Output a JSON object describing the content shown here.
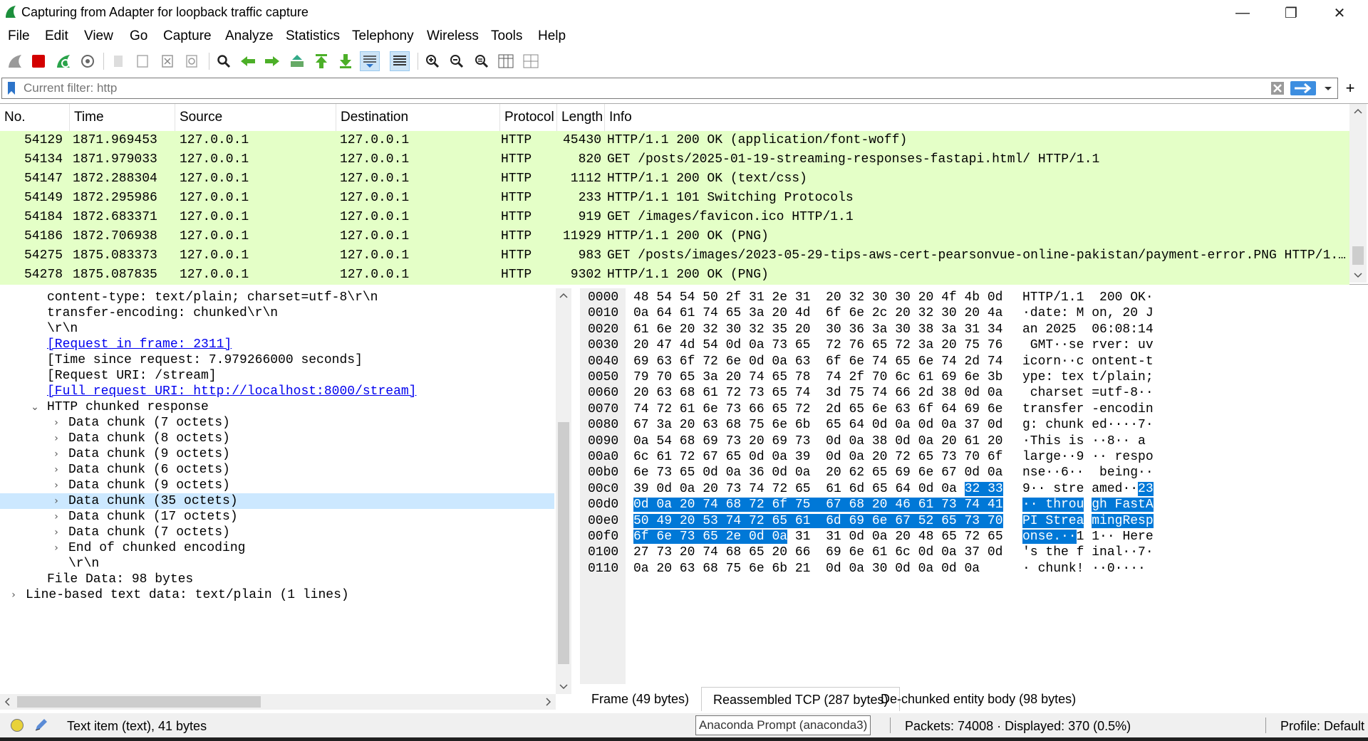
{
  "window": {
    "title": "Capturing from Adapter for loopback traffic capture",
    "minimize": "—",
    "restore": "❐",
    "close": "✕"
  },
  "menu": [
    "File",
    "Edit",
    "View",
    "Go",
    "Capture",
    "Analyze",
    "Statistics",
    "Telephony",
    "Wireless",
    "Tools",
    "Help"
  ],
  "filter": {
    "placeholder": "Current filter: http",
    "add_label": "+"
  },
  "packet_columns": [
    "No.",
    "Time",
    "Source",
    "Destination",
    "Protocol",
    "Length",
    "Info"
  ],
  "packets": [
    {
      "no": "54129",
      "time": "1871.969453",
      "src": "127.0.0.1",
      "dst": "127.0.0.1",
      "proto": "HTTP",
      "len": "45430",
      "info": "HTTP/1.1 200 OK  (application/font-woff)"
    },
    {
      "no": "54134",
      "time": "1871.979033",
      "src": "127.0.0.1",
      "dst": "127.0.0.1",
      "proto": "HTTP",
      "len": "820",
      "info": "GET /posts/2025-01-19-streaming-responses-fastapi.html/ HTTP/1.1"
    },
    {
      "no": "54147",
      "time": "1872.288304",
      "src": "127.0.0.1",
      "dst": "127.0.0.1",
      "proto": "HTTP",
      "len": "1112",
      "info": "HTTP/1.1 200 OK  (text/css)"
    },
    {
      "no": "54149",
      "time": "1872.295986",
      "src": "127.0.0.1",
      "dst": "127.0.0.1",
      "proto": "HTTP",
      "len": "233",
      "info": "HTTP/1.1 101 Switching Protocols"
    },
    {
      "no": "54184",
      "time": "1872.683371",
      "src": "127.0.0.1",
      "dst": "127.0.0.1",
      "proto": "HTTP",
      "len": "919",
      "info": "GET /images/favicon.ico HTTP/1.1"
    },
    {
      "no": "54186",
      "time": "1872.706938",
      "src": "127.0.0.1",
      "dst": "127.0.0.1",
      "proto": "HTTP",
      "len": "11929",
      "info": "HTTP/1.1 200 OK  (PNG)"
    },
    {
      "no": "54275",
      "time": "1875.083373",
      "src": "127.0.0.1",
      "dst": "127.0.0.1",
      "proto": "HTTP",
      "len": "983",
      "info": "GET /posts/images/2023-05-29-tips-aws-cert-pearsonvue-online-pakistan/payment-error.PNG HTTP/1.…"
    },
    {
      "no": "54278",
      "time": "1875.087835",
      "src": "127.0.0.1",
      "dst": "127.0.0.1",
      "proto": "HTTP",
      "len": "9302",
      "info": "HTTP/1.1 200 OK  (PNG)"
    }
  ],
  "detail_rows": [
    {
      "text": "content-type: text/plain; charset=utf-8\\r\\n",
      "indent": 1,
      "twisty": ""
    },
    {
      "text": "transfer-encoding: chunked\\r\\n",
      "indent": 1,
      "twisty": ""
    },
    {
      "text": "\\r\\n",
      "indent": 1,
      "twisty": ""
    },
    {
      "text": "[Request in frame: 2311]",
      "indent": 1,
      "twisty": "",
      "link": true
    },
    {
      "text": "[Time since request: 7.979266000 seconds]",
      "indent": 1,
      "twisty": ""
    },
    {
      "text": "[Request URI: /stream]",
      "indent": 1,
      "twisty": ""
    },
    {
      "text": "[Full request URI: http://localhost:8000/stream]",
      "indent": 1,
      "twisty": "",
      "link": true
    },
    {
      "text": "HTTP chunked response",
      "indent": 1,
      "twisty": "open"
    },
    {
      "text": "Data chunk (7 octets)",
      "indent": 2,
      "twisty": "closed"
    },
    {
      "text": "Data chunk (8 octets)",
      "indent": 2,
      "twisty": "closed"
    },
    {
      "text": "Data chunk (9 octets)",
      "indent": 2,
      "twisty": "closed"
    },
    {
      "text": "Data chunk (6 octets)",
      "indent": 2,
      "twisty": "closed"
    },
    {
      "text": "Data chunk (9 octets)",
      "indent": 2,
      "twisty": "closed"
    },
    {
      "text": "Data chunk (35 octets)",
      "indent": 2,
      "twisty": "closed",
      "selected": true
    },
    {
      "text": "Data chunk (17 octets)",
      "indent": 2,
      "twisty": "closed"
    },
    {
      "text": "Data chunk (7 octets)",
      "indent": 2,
      "twisty": "closed"
    },
    {
      "text": "End of chunked encoding",
      "indent": 2,
      "twisty": "closed"
    },
    {
      "text": "\\r\\n",
      "indent": 2,
      "twisty": ""
    },
    {
      "text": "File Data: 98 bytes",
      "indent": 1,
      "twisty": ""
    },
    {
      "text": "Line-based text data: text/plain (1 lines)",
      "indent": 0,
      "twisty": "closed"
    }
  ],
  "hex_rows": [
    {
      "off": "0000",
      "hex": "48 54 54 50 2f 31 2e 31  20 32 30 30 20 4f 4b 0d",
      "ascii": "HTTP/1.1  200 OK·"
    },
    {
      "off": "0010",
      "hex": "0a 64 61 74 65 3a 20 4d  6f 6e 2c 20 32 30 20 4a",
      "ascii": "·date: M on, 20 J"
    },
    {
      "off": "0020",
      "hex": "61 6e 20 32 30 32 35 20  30 36 3a 30 38 3a 31 34",
      "ascii": "an 2025  06:08:14"
    },
    {
      "off": "0030",
      "hex": "20 47 4d 54 0d 0a 73 65  72 76 65 72 3a 20 75 76",
      "ascii": " GMT··se rver: uv"
    },
    {
      "off": "0040",
      "hex": "69 63 6f 72 6e 0d 0a 63  6f 6e 74 65 6e 74 2d 74",
      "ascii": "icorn··c ontent-t"
    },
    {
      "off": "0050",
      "hex": "79 70 65 3a 20 74 65 78  74 2f 70 6c 61 69 6e 3b",
      "ascii": "ype: tex t/plain;"
    },
    {
      "off": "0060",
      "hex": "20 63 68 61 72 73 65 74  3d 75 74 66 2d 38 0d 0a",
      "ascii": " charset =utf-8··"
    },
    {
      "off": "0070",
      "hex": "74 72 61 6e 73 66 65 72  2d 65 6e 63 6f 64 69 6e",
      "ascii": "transfer -encodin"
    },
    {
      "off": "0080",
      "hex": "67 3a 20 63 68 75 6e 6b  65 64 0d 0a 0d 0a 37 0d",
      "ascii": "g: chunk ed····7·"
    },
    {
      "off": "0090",
      "hex": "0a 54 68 69 73 20 69 73  0d 0a 38 0d 0a 20 61 20",
      "ascii": "·This is ··8·· a "
    },
    {
      "off": "00a0",
      "hex": "6c 61 72 67 65 0d 0a 39  0d 0a 20 72 65 73 70 6f",
      "ascii": "large··9 ·· respo"
    },
    {
      "off": "00b0",
      "hex": "6e 73 65 0d 0a 36 0d 0a  20 62 65 69 6e 67 0d 0a",
      "ascii": "nse··6··  being··"
    },
    {
      "off": "00c0",
      "hex": "39 0d 0a 20 73 74 72 65  61 6d 65 64 0d 0a 32 33",
      "ascii": "9·· stre amed··23"
    },
    {
      "off": "00d0",
      "hex": "0d 0a 20 74 68 72 6f 75  67 68 20 46 61 73 74 41",
      "ascii": "·· throu gh FastA"
    },
    {
      "off": "00e0",
      "hex": "50 49 20 53 74 72 65 61  6d 69 6e 67 52 65 73 70",
      "ascii": "PI Strea mingResp"
    },
    {
      "off": "00f0",
      "hex": "6f 6e 73 65 2e 0d 0a 31  31 0d 0a 20 48 65 72 65",
      "ascii": "onse.··1 1·· Here"
    },
    {
      "off": "0100",
      "hex": "27 73 20 74 68 65 20 66  69 6e 61 6c 0d 0a 37 0d",
      "ascii": "'s the f inal··7·"
    },
    {
      "off": "0110",
      "hex": "0a 20 63 68 75 6e 6b 21  0d 0a 30 0d 0a 0d 0a",
      "ascii": "· chunk! ··0····"
    }
  ],
  "byte_tabs": [
    "Frame (49 bytes)",
    "Reassembled TCP (287 bytes)",
    "De-chunked entity body (98 bytes)"
  ],
  "status": {
    "item": "Text item (text), 41 bytes",
    "tooltip": "Anaconda Prompt (anaconda3)",
    "packets": "Packets: 74008 · Displayed: 370 (0.5%)",
    "profile": "Profile: Default"
  },
  "colors": {
    "http_row": "#e4ffc7",
    "selection": "#0078d7",
    "tree_selection": "#cce8ff"
  }
}
